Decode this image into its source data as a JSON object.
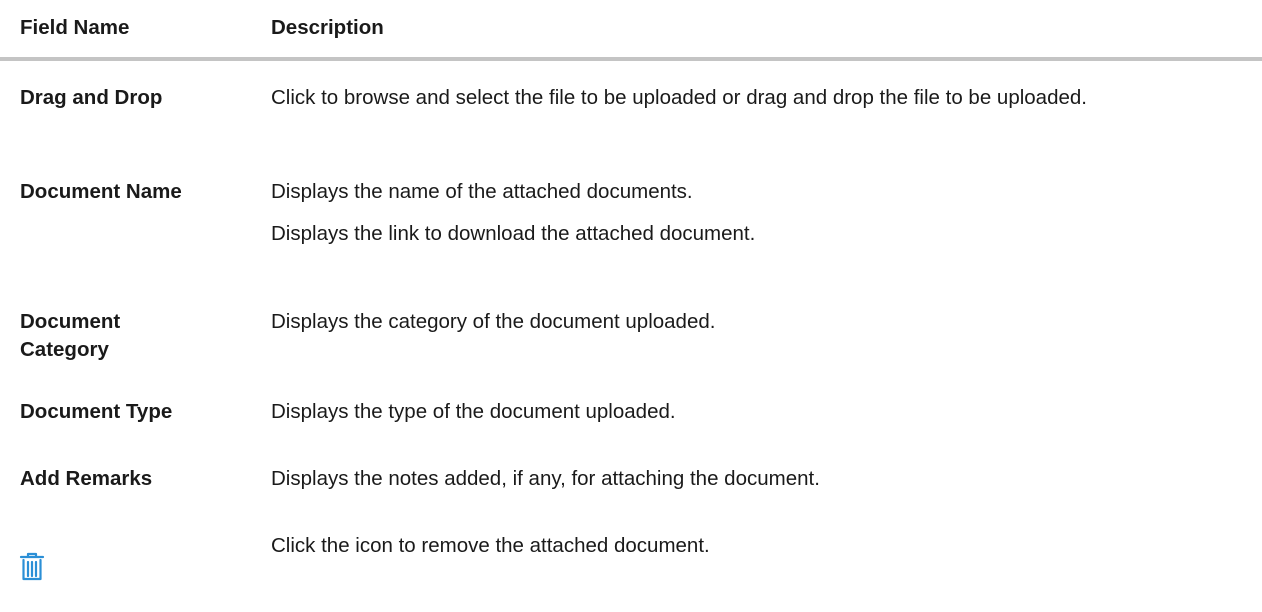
{
  "header": {
    "field_name": "Field Name",
    "description": "Description"
  },
  "rows": [
    {
      "name": "Drag and Drop",
      "descriptions": [
        "Click to browse and select the file to be uploaded or drag and drop the file to be uploaded."
      ]
    },
    {
      "name": "Document Name",
      "descriptions": [
        "Displays the name of the attached documents.",
        "Displays the link to download the attached document."
      ]
    },
    {
      "name": "Document Category",
      "descriptions": [
        "Displays the category of the document uploaded."
      ]
    },
    {
      "name": "Document Type",
      "descriptions": [
        "Displays the type of the document uploaded."
      ]
    },
    {
      "name": "Add Remarks",
      "descriptions": [
        "Displays the notes added, if any, for attaching the document."
      ]
    },
    {
      "icon": "trash-icon",
      "icon_color": "#2b8fd6",
      "descriptions": [
        "Click the icon to remove the attached document."
      ]
    }
  ]
}
